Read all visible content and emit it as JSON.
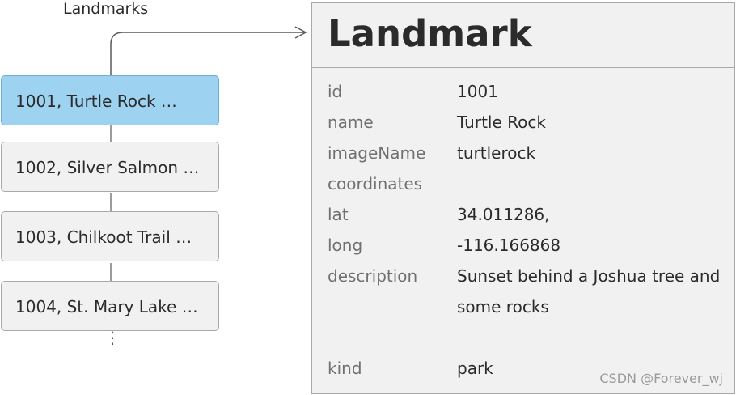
{
  "list": {
    "title": "Landmarks",
    "items": [
      {
        "label": "1001, Turtle Rock …",
        "selected": true
      },
      {
        "label": "1002, Silver Salmon …",
        "selected": false
      },
      {
        "label": "1003, Chilkoot Trail …",
        "selected": false
      },
      {
        "label": "1004, St. Mary Lake …",
        "selected": false
      }
    ],
    "more": "⋮"
  },
  "detail": {
    "title": "Landmark",
    "fields": [
      {
        "key": "id",
        "value": "1001"
      },
      {
        "key": "name",
        "value": "Turtle Rock"
      },
      {
        "key": "imageName",
        "value": "turtlerock"
      },
      {
        "key": "coordinates",
        "value": ""
      },
      {
        "key": "lat",
        "value": "34.011286,"
      },
      {
        "key": "long",
        "value": "-116.166868"
      },
      {
        "key": "description",
        "value": "Sunset behind a Joshua tree and some rocks"
      },
      {
        "key": "kind",
        "value": "park"
      }
    ]
  },
  "watermark": "CSDN @Forever_wj",
  "colors": {
    "selected_fill": "#9dd3f1",
    "item_fill": "#f1f1f1",
    "border": "#a9a9a9",
    "key_text": "#707070",
    "value_text": "#2b2b2b"
  }
}
